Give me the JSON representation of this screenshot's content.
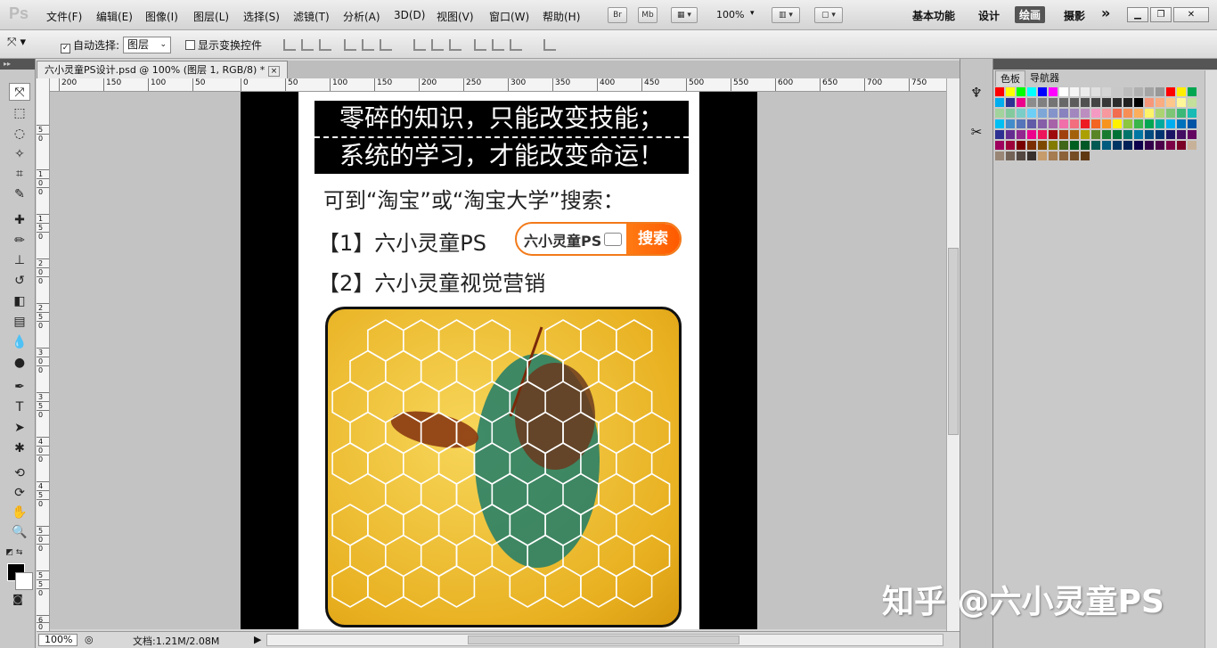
{
  "app": {
    "logo": "Ps"
  },
  "menu": [
    "文件(F)",
    "编辑(E)",
    "图像(I)",
    "图层(L)",
    "选择(S)",
    "滤镜(T)",
    "分析(A)",
    "3D(D)",
    "视图(V)",
    "窗口(W)",
    "帮助(H)"
  ],
  "app_bar": {
    "bridge": "Br",
    "mini_bridge": "Mb",
    "zoom": "100%"
  },
  "workspaces": [
    "基本功能",
    "设计",
    "绘画",
    "摄影"
  ],
  "active_workspace": "绘画",
  "more_glyph": "»",
  "options": {
    "auto_select_label": "自动选择:",
    "auto_select_checked": true,
    "target": "图层",
    "transform_controls_label": "显示变换控件",
    "transform_controls_checked": false
  },
  "document": {
    "tab_title": "六小灵童PS设计.psd @ 100% (图层 1, RGB/8) *",
    "close": "×"
  },
  "ruler_h": [
    "200",
    "150",
    "100",
    "50",
    "0",
    "50",
    "100",
    "150",
    "200",
    "250",
    "300",
    "350",
    "400",
    "450",
    "500",
    "550",
    "600",
    "650",
    "700",
    "750"
  ],
  "ruler_v": [
    "5",
    "0",
    "1",
    "0",
    "0",
    "1",
    "5",
    "0",
    "2",
    "0",
    "0",
    "2",
    "5",
    "0",
    "3",
    "0",
    "0",
    "3",
    "5",
    "0",
    "4",
    "0",
    "0",
    "4",
    "5",
    "0",
    "5",
    "0",
    "0",
    "5",
    "5",
    "0",
    "6",
    "0",
    "0"
  ],
  "canvas": {
    "banner_line1": "零碎的知识，只能改变技能；",
    "banner_line2": "系统的学习，才能改变命运！",
    "search_hint": "可到“淘宝”或“淘宝大学”搜索：",
    "item1": "【1】六小灵童PS",
    "item2": "【2】六小灵童视觉营销",
    "searchbox_text": "六小灵童PS",
    "search_button": "搜索"
  },
  "status": {
    "zoom": "100%",
    "doc_info": "文档:1.21M/2.08M"
  },
  "panel_tabs": [
    "色板",
    "导航器"
  ],
  "watermark": "知乎 @六小灵童PS",
  "colors": {
    "swatches": [
      "#ff0000",
      "#ffff00",
      "#00ff00",
      "#00ffff",
      "#0000ff",
      "#ff00ff",
      "#ffffff",
      "#f5f5f5",
      "#ececec",
      "#e0e0e0",
      "#d4d4d4",
      "#c8c8c8",
      "#bcbcbc",
      "#b0b0b0",
      "#a4a4a4",
      "#989898",
      "#ff0000",
      "#ffee00",
      "#00a650",
      "#00aeef",
      "#2e3192",
      "#ec008c",
      "#8c8c8c",
      "#808080",
      "#747474",
      "#686868",
      "#5c5c5c",
      "#505050",
      "#444444",
      "#383838",
      "#2c2c2c",
      "#202020",
      "#000000",
      "#f7977a",
      "#f9ad81",
      "#fdc68a",
      "#fff79a",
      "#c4df9b",
      "#a3d39c",
      "#82ca9d",
      "#7bcdc8",
      "#6ecff6",
      "#7ea7d8",
      "#8493ca",
      "#8882be",
      "#a187be",
      "#bc8dbf",
      "#f49ac2",
      "#f6989d",
      "#f26c4f",
      "#f68e55",
      "#fbaf5c",
      "#fff467",
      "#acd372",
      "#7cc576",
      "#3bb878",
      "#1abbb4",
      "#00bff3",
      "#438ccb",
      "#5574b9",
      "#605ca8",
      "#855fa8",
      "#a763a8",
      "#f06ea9",
      "#f26d7d",
      "#ed1c24",
      "#f26522",
      "#f7941d",
      "#fff200",
      "#8dc63f",
      "#39b54a",
      "#00a651",
      "#00a99d",
      "#00aeef",
      "#0072bc",
      "#0054a6",
      "#2e3192",
      "#662d91",
      "#92278f",
      "#ec008c",
      "#ed145b",
      "#9e0b0f",
      "#a0410d",
      "#a36209",
      "#aba000",
      "#598527",
      "#197b30",
      "#007236",
      "#00746b",
      "#0076a3",
      "#004b80",
      "#003471",
      "#1b1464",
      "#440e62",
      "#630460",
      "#9e005d",
      "#9e0039",
      "#790000",
      "#7b2e00",
      "#7d4900",
      "#827b00",
      "#406618",
      "#005e20",
      "#005826",
      "#005952",
      "#005b7f",
      "#003663",
      "#002157",
      "#0d004c",
      "#32004b",
      "#4b0049",
      "#7b0046",
      "#7a0026",
      "#c7b299",
      "#998675",
      "#736357",
      "#534741",
      "#37302d",
      "#c69c6d",
      "#a67c52",
      "#8c6239",
      "#754c24",
      "#603913"
    ]
  }
}
